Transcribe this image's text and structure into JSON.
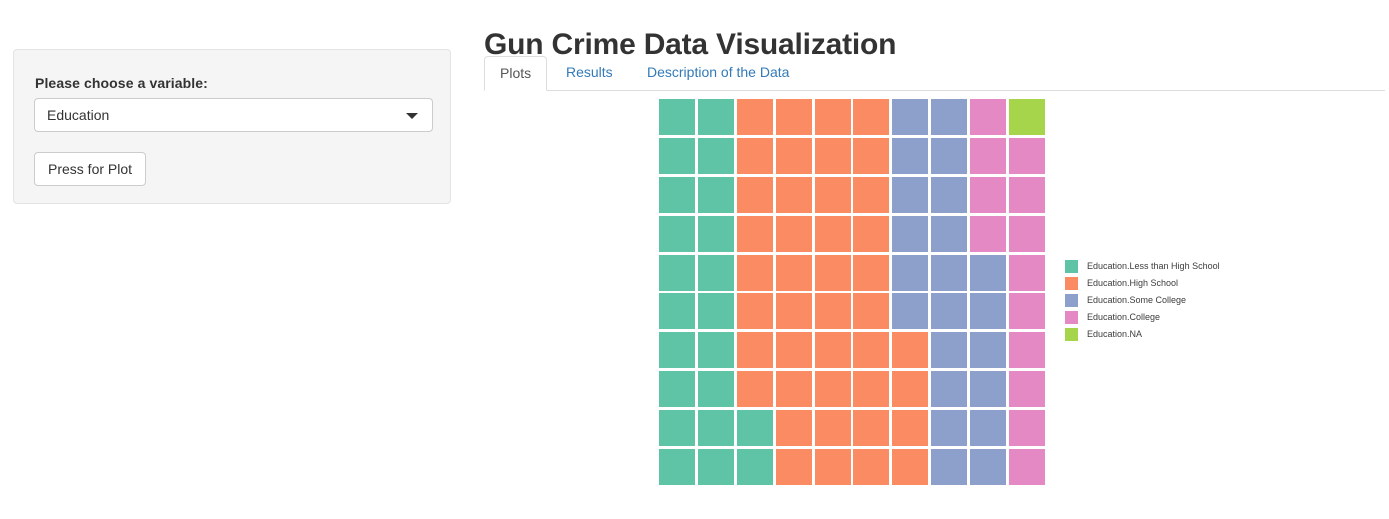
{
  "header": {
    "title": "Gun Crime Data Visualization"
  },
  "tabs": [
    {
      "label": "Plots",
      "active": true
    },
    {
      "label": "Results",
      "active": false
    },
    {
      "label": "Description of the Data",
      "active": false
    }
  ],
  "sidebar": {
    "variable_label": "Please choose a variable:",
    "select": {
      "value": "Education",
      "caret_icon": "chevron-down-icon"
    },
    "plot_button_label": "Press for Plot"
  },
  "palette": {
    "less_than_high_school": "#5FC4A5",
    "high_school": "#FB8B62",
    "some_college": "#8DA0CB",
    "college": "#E589C4",
    "na": "#A6D44B",
    "empty": "transparent"
  },
  "legend": [
    {
      "label": "Education.Less than High School",
      "color": "#5FC4A5"
    },
    {
      "label": "Education.High School",
      "color": "#FB8B62"
    },
    {
      "label": "Education.Some College",
      "color": "#8DA0CB"
    },
    {
      "label": "Education.College",
      "color": "#E589C4"
    },
    {
      "label": "Education.NA",
      "color": "#A6D44B"
    }
  ],
  "chart_data": {
    "type": "waffle",
    "title": "",
    "rows": 10,
    "columns": 10,
    "unit": "1 square = 1 percent",
    "categories": [
      "Education.Less than High School",
      "Education.High School",
      "Education.Some College",
      "Education.College",
      "Education.NA"
    ],
    "colors": [
      "#5FC4A5",
      "#FB8B62",
      "#8DA0CB",
      "#E589C4",
      "#A6D44B"
    ],
    "values": [
      22,
      43,
      23,
      11,
      1
    ],
    "ylabel": "",
    "xlabel": "",
    "legend_position": "right",
    "grid": false,
    "cells": [
      [
        "less_than_high_school",
        "less_than_high_school",
        "high_school",
        "high_school",
        "high_school",
        "high_school",
        "some_college",
        "some_college",
        "college",
        "na"
      ],
      [
        "less_than_high_school",
        "less_than_high_school",
        "high_school",
        "high_school",
        "high_school",
        "high_school",
        "some_college",
        "some_college",
        "college",
        "college"
      ],
      [
        "less_than_high_school",
        "less_than_high_school",
        "high_school",
        "high_school",
        "high_school",
        "high_school",
        "some_college",
        "some_college",
        "college",
        "college"
      ],
      [
        "less_than_high_school",
        "less_than_high_school",
        "high_school",
        "high_school",
        "high_school",
        "high_school",
        "some_college",
        "some_college",
        "college",
        "college"
      ],
      [
        "less_than_high_school",
        "less_than_high_school",
        "high_school",
        "high_school",
        "high_school",
        "high_school",
        "some_college",
        "some_college",
        "some_college",
        "college"
      ],
      [
        "less_than_high_school",
        "less_than_high_school",
        "high_school",
        "high_school",
        "high_school",
        "high_school",
        "some_college",
        "some_college",
        "some_college",
        "college"
      ],
      [
        "less_than_high_school",
        "less_than_high_school",
        "high_school",
        "high_school",
        "high_school",
        "high_school",
        "high_school",
        "some_college",
        "some_college",
        "college"
      ],
      [
        "less_than_high_school",
        "less_than_high_school",
        "high_school",
        "high_school",
        "high_school",
        "high_school",
        "high_school",
        "some_college",
        "some_college",
        "college"
      ],
      [
        "less_than_high_school",
        "less_than_high_school",
        "less_than_high_school",
        "high_school",
        "high_school",
        "high_school",
        "high_school",
        "some_college",
        "some_college",
        "college"
      ],
      [
        "less_than_high_school",
        "less_than_high_school",
        "less_than_high_school",
        "high_school",
        "high_school",
        "high_school",
        "high_school",
        "some_college",
        "some_college",
        "college"
      ]
    ]
  }
}
